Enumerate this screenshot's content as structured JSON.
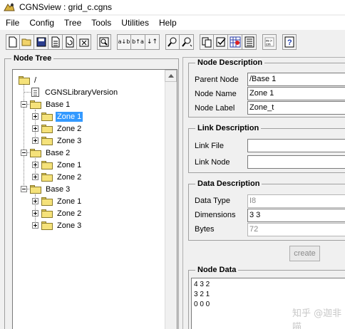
{
  "window": {
    "title": "CGNSview : grid_c.cgns",
    "app_icon": "cgns-app-icon"
  },
  "menu": [
    "File",
    "Config",
    "Tree",
    "Tools",
    "Utilities",
    "Help"
  ],
  "toolbar": {
    "buttons": [
      {
        "icon": "new-file-icon",
        "glyph": "🗋"
      },
      {
        "icon": "open-folder-icon",
        "glyph": "📂"
      },
      {
        "icon": "save-icon",
        "glyph": "💾"
      },
      {
        "icon": "save-as-icon",
        "glyph": "🖹"
      },
      {
        "icon": "reload-icon",
        "glyph": "↻"
      },
      {
        "icon": "print-icon",
        "glyph": "⎙"
      },
      {
        "icon": "view-icon",
        "glyph": "⧉"
      },
      {
        "icon": "sort-ab-icon",
        "glyph": "ab"
      },
      {
        "icon": "sort-ba-icon",
        "glyph": "ba"
      },
      {
        "icon": "sort-up-icon",
        "glyph": "↕"
      },
      {
        "icon": "search-icon",
        "glyph": "🔍"
      },
      {
        "icon": "search-next-icon",
        "glyph": "🔎"
      },
      {
        "icon": "copy-icon",
        "glyph": "⎘"
      },
      {
        "icon": "check-icon",
        "glyph": "☑"
      },
      {
        "icon": "grid-icon",
        "glyph": "▦"
      },
      {
        "icon": "table-icon",
        "glyph": "▤"
      },
      {
        "icon": "units-icon",
        "glyph": "⇆"
      },
      {
        "icon": "help-icon",
        "glyph": "?"
      }
    ]
  },
  "node_tree": {
    "legend": "Node Tree",
    "root": "/",
    "library_version": "CGNSLibraryVersion",
    "bases": [
      {
        "label": "Base 1",
        "zones": [
          "Zone 1",
          "Zone 2",
          "Zone 3"
        ]
      },
      {
        "label": "Base 2",
        "zones": [
          "Zone 1",
          "Zone 2"
        ]
      },
      {
        "label": "Base 3",
        "zones": [
          "Zone 1",
          "Zone 2",
          "Zone 3"
        ]
      }
    ],
    "selected": "Base 1 / Zone 1"
  },
  "node_description": {
    "legend": "Node Description",
    "parent_node_label": "Parent Node",
    "parent_node": "/Base 1",
    "node_name_label": "Node Name",
    "node_name": "Zone 1",
    "node_label_label": "Node Label",
    "node_label": "Zone_t"
  },
  "link_description": {
    "legend": "Link Description",
    "link_file_label": "Link File",
    "link_file": "",
    "link_node_label": "Link Node",
    "link_node": ""
  },
  "data_description": {
    "legend": "Data Description",
    "data_type_label": "Data Type",
    "data_type": "I8",
    "dimensions_label": "Dimensions",
    "dimensions": "3 3",
    "bytes_label": "Bytes",
    "bytes": "72",
    "create_label": "create"
  },
  "node_data": {
    "legend": "Node Data",
    "rows": [
      "4 3 2",
      "3 2 1",
      "0 0 0"
    ]
  },
  "watermark": "知乎 @迦非喵"
}
